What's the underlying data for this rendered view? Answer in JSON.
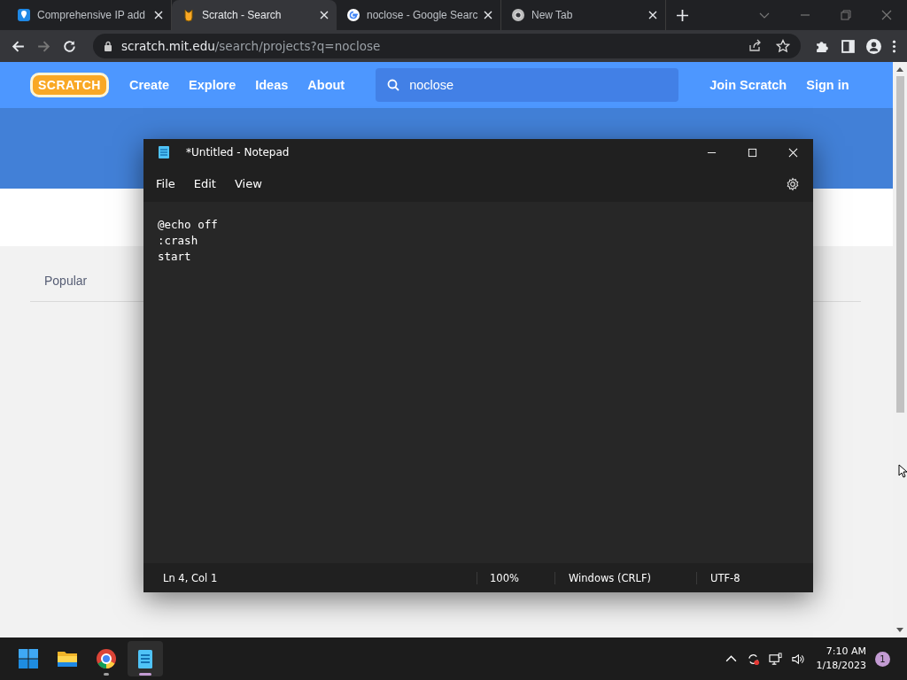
{
  "browser": {
    "tabs": [
      {
        "title": "Comprehensive IP add",
        "kind": "pin",
        "selected": false
      },
      {
        "title": "Scratch - Search",
        "kind": "cat",
        "selected": true
      },
      {
        "title": "noclose - Google Searc",
        "kind": "google",
        "selected": false
      },
      {
        "title": "New Tab",
        "kind": "chrome",
        "selected": false
      }
    ],
    "address": {
      "host": "scratch.mit.edu",
      "path": "/search/projects?q=noclose"
    }
  },
  "scratch": {
    "logo": "SCRATCH",
    "nav": [
      "Create",
      "Explore",
      "Ideas",
      "About"
    ],
    "search": {
      "value": "noclose"
    },
    "join": "Join Scratch",
    "signin": "Sign in",
    "filter_tab": "Popular"
  },
  "notepad": {
    "title": "*Untitled - Notepad",
    "menu": [
      "File",
      "Edit",
      "View"
    ],
    "lines": [
      "@echo off",
      ":crash",
      "start"
    ],
    "status": [
      "Ln 4, Col 1",
      "100%",
      "Windows (CRLF)",
      "UTF-8"
    ]
  },
  "taskbar": {
    "apps": [
      {
        "kind": "start",
        "active": false
      },
      {
        "kind": "folder",
        "active": false
      },
      {
        "kind": "chrome",
        "active": false,
        "running": true
      },
      {
        "kind": "notepad",
        "active": true,
        "running": true
      }
    ],
    "time": "7:10 AM",
    "date": "1/18/2023",
    "notifications": "1"
  }
}
